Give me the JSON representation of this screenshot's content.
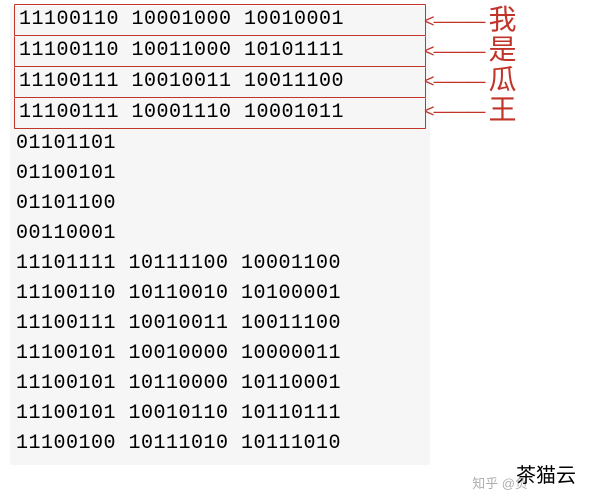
{
  "rows": [
    {
      "bits": "11100110 10001000 10010001",
      "boxed": true,
      "label": "我"
    },
    {
      "bits": "11100110 10011000 10101111",
      "boxed": true,
      "label": "是"
    },
    {
      "bits": "11100111 10010011 10011100",
      "boxed": true,
      "label": "瓜"
    },
    {
      "bits": "11100111 10001110 10001011",
      "boxed": true,
      "label": "王"
    },
    {
      "bits": "01101101",
      "boxed": false
    },
    {
      "bits": "01100101",
      "boxed": false
    },
    {
      "bits": "01101100",
      "boxed": false
    },
    {
      "bits": "00110001",
      "boxed": false
    },
    {
      "bits": "11101111 10111100 10001100",
      "boxed": false
    },
    {
      "bits": "11100110 10110010 10100001",
      "boxed": false
    },
    {
      "bits": "11100111 10010011 10011100",
      "boxed": false
    },
    {
      "bits": "11100101 10010000 10000011",
      "boxed": false
    },
    {
      "bits": "11100101 10110000 10110001",
      "boxed": false
    },
    {
      "bits": "11100101 10010110 10110111",
      "boxed": false
    },
    {
      "bits": "11100100 10111010 10111010",
      "boxed": false
    }
  ],
  "arrow_glyph": "<———",
  "watermark_source": "知乎 @负",
  "watermark_brand": "茶猫云"
}
